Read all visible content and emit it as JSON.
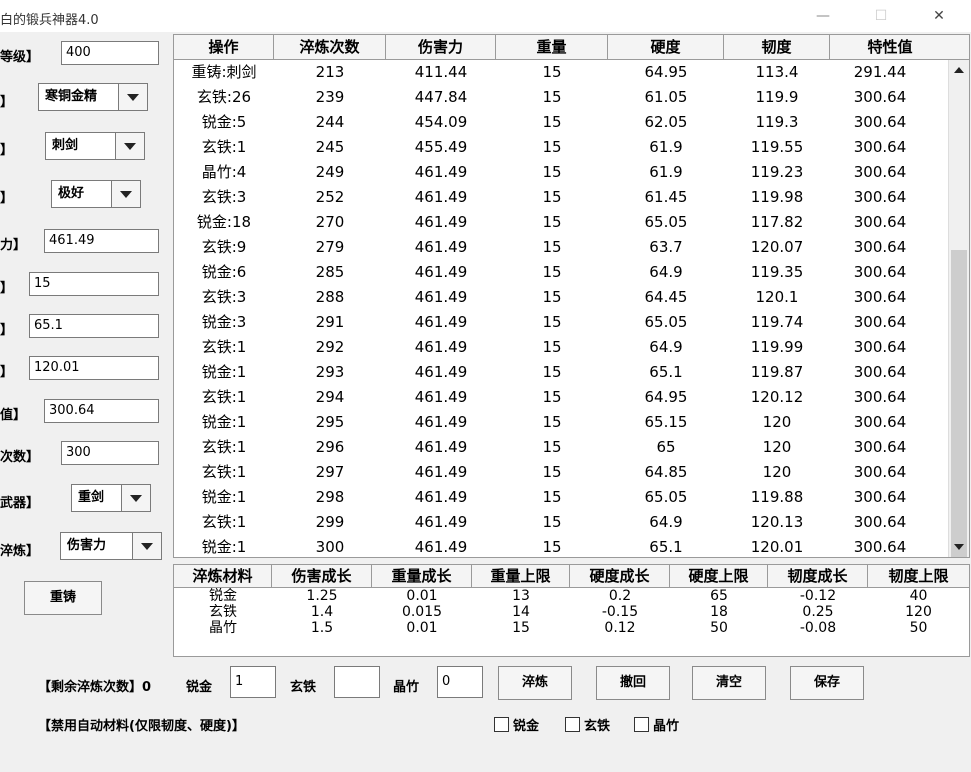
{
  "window": {
    "title": "白的锻兵神器4.0",
    "minimize_glyph": "—",
    "maximize_glyph": "☐",
    "close_glyph": "✕"
  },
  "left_panel": {
    "rows": [
      {
        "label": "等级】",
        "value": "400"
      },
      {
        "label": "】",
        "value": "寒铜金精"
      },
      {
        "label": "】",
        "value": "刺剑"
      },
      {
        "label": "】",
        "value": "极好"
      },
      {
        "label": "力】",
        "value": "461.49"
      },
      {
        "label": "】",
        "value": "15"
      },
      {
        "label": "】",
        "value": "65.1"
      },
      {
        "label": "】",
        "value": "120.01"
      },
      {
        "label": "值】",
        "value": "300.64"
      },
      {
        "label": "次数】",
        "value": "300"
      },
      {
        "label": "武器】",
        "value": "重剑"
      },
      {
        "label": "淬炼】",
        "value": "伤害力"
      }
    ],
    "recast_button": "重铸"
  },
  "main_table": {
    "headers": [
      "操作",
      "淬炼次数",
      "伤害力",
      "重量",
      "硬度",
      "韧度",
      "特性值"
    ],
    "rows": [
      [
        "重铸:刺剑",
        "213",
        "411.44",
        "15",
        "64.95",
        "113.4",
        "291.44"
      ],
      [
        "玄铁:26",
        "239",
        "447.84",
        "15",
        "61.05",
        "119.9",
        "300.64"
      ],
      [
        "锐金:5",
        "244",
        "454.09",
        "15",
        "62.05",
        "119.3",
        "300.64"
      ],
      [
        "玄铁:1",
        "245",
        "455.49",
        "15",
        "61.9",
        "119.55",
        "300.64"
      ],
      [
        "晶竹:4",
        "249",
        "461.49",
        "15",
        "61.9",
        "119.23",
        "300.64"
      ],
      [
        "玄铁:3",
        "252",
        "461.49",
        "15",
        "61.45",
        "119.98",
        "300.64"
      ],
      [
        "锐金:18",
        "270",
        "461.49",
        "15",
        "65.05",
        "117.82",
        "300.64"
      ],
      [
        "玄铁:9",
        "279",
        "461.49",
        "15",
        "63.7",
        "120.07",
        "300.64"
      ],
      [
        "锐金:6",
        "285",
        "461.49",
        "15",
        "64.9",
        "119.35",
        "300.64"
      ],
      [
        "玄铁:3",
        "288",
        "461.49",
        "15",
        "64.45",
        "120.1",
        "300.64"
      ],
      [
        "锐金:3",
        "291",
        "461.49",
        "15",
        "65.05",
        "119.74",
        "300.64"
      ],
      [
        "玄铁:1",
        "292",
        "461.49",
        "15",
        "64.9",
        "119.99",
        "300.64"
      ],
      [
        "锐金:1",
        "293",
        "461.49",
        "15",
        "65.1",
        "119.87",
        "300.64"
      ],
      [
        "玄铁:1",
        "294",
        "461.49",
        "15",
        "64.95",
        "120.12",
        "300.64"
      ],
      [
        "锐金:1",
        "295",
        "461.49",
        "15",
        "65.15",
        "120",
        "300.64"
      ],
      [
        "玄铁:1",
        "296",
        "461.49",
        "15",
        "65",
        "120",
        "300.64"
      ],
      [
        "玄铁:1",
        "297",
        "461.49",
        "15",
        "64.85",
        "120",
        "300.64"
      ],
      [
        "锐金:1",
        "298",
        "461.49",
        "15",
        "65.05",
        "119.88",
        "300.64"
      ],
      [
        "玄铁:1",
        "299",
        "461.49",
        "15",
        "64.9",
        "120.13",
        "300.64"
      ],
      [
        "锐金:1",
        "300",
        "461.49",
        "15",
        "65.1",
        "120.01",
        "300.64"
      ]
    ]
  },
  "material_table": {
    "headers": [
      "淬炼材料",
      "伤害成长",
      "重量成长",
      "重量上限",
      "硬度成长",
      "硬度上限",
      "韧度成长",
      "韧度上限"
    ],
    "rows": [
      [
        "锐金",
        "1.25",
        "0.01",
        "13",
        "0.2",
        "65",
        "-0.12",
        "40"
      ],
      [
        "玄铁",
        "1.4",
        "0.015",
        "14",
        "-0.15",
        "18",
        "0.25",
        "120"
      ],
      [
        "晶竹",
        "1.5",
        "0.01",
        "15",
        "0.12",
        "50",
        "-0.08",
        "50"
      ]
    ]
  },
  "bottom": {
    "remaining_label": "【剩余淬炼次数】0",
    "ruijin_label": "锐金",
    "ruijin_value": "1",
    "xuantie_label": "玄铁",
    "xuantie_value": "",
    "jingzhu_label": "晶竹",
    "jingzhu_value": "0",
    "buttons": {
      "temper": "淬炼",
      "undo": "撤回",
      "clear": "清空",
      "save": "保存"
    },
    "disable_label": "【禁用自动材料(仅限韧度、硬度)】",
    "checkboxes": [
      "锐金",
      "玄铁",
      "晶竹"
    ]
  }
}
